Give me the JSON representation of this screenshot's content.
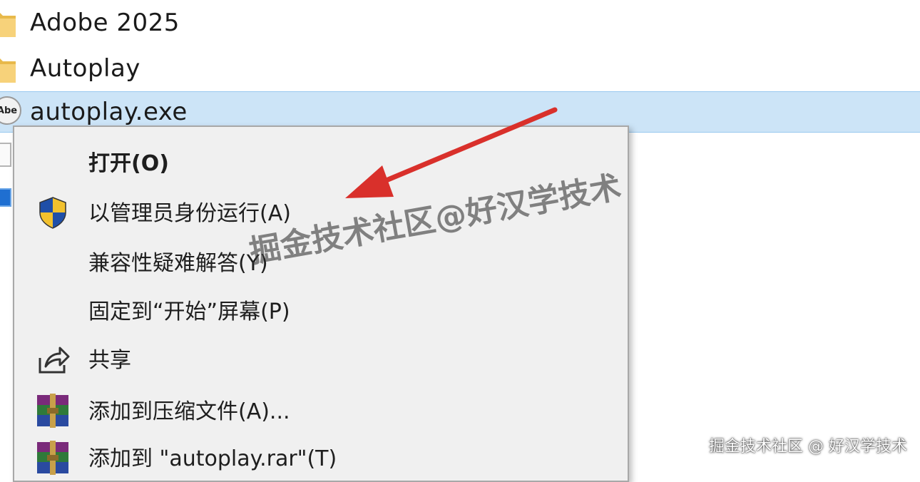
{
  "files": [
    {
      "name": "Adobe 2025",
      "icon": "folder-icon"
    },
    {
      "name": "Autoplay",
      "icon": "folder-icon"
    },
    {
      "name": "autoplay.exe",
      "icon": "adobe-app-icon",
      "icon_text": "Abe",
      "selected": true
    }
  ],
  "context_menu": {
    "items": [
      {
        "label": "打开(O)",
        "bold": true
      },
      {
        "label": "以管理员身份运行(A)",
        "icon": "uac-shield-icon"
      },
      {
        "label": "兼容性疑难解答(Y)"
      },
      {
        "label": "固定到“开始”屏幕(P)"
      },
      {
        "label": "共享",
        "icon": "share-icon"
      },
      {
        "label": "添加到压缩文件(A)...",
        "icon": "winrar-icon"
      },
      {
        "label": "添加到 \"autoplay.rar\"(T)",
        "icon": "winrar-icon"
      }
    ]
  },
  "watermarks": {
    "overlay": "掘金技术社区@好汉学技术",
    "corner": "掘金技术社区 @ 好汉学技术"
  },
  "colors": {
    "selection": "#cce4f7",
    "menu_bg": "#f0f0f0",
    "arrow": "#d9302b"
  }
}
